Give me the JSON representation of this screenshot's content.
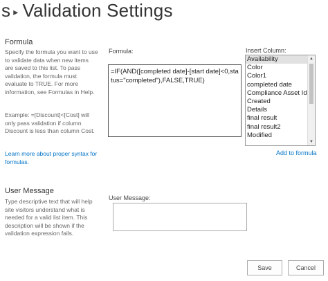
{
  "page": {
    "title_prefix": "s",
    "title": "Validation Settings"
  },
  "formula_section": {
    "heading": "Formula",
    "description": "Specify the formula you want to use to validate data when new items are saved to this list. To pass validation, the formula must evaluate to TRUE. For more information, see Formulas in Help.",
    "example": "Example: =[Discount]<[Cost] will only pass validation if column Discount is less than column Cost.",
    "learn_more": "Learn more about proper syntax for formulas.",
    "formula_label": "Formula:",
    "formula_value": "=IF(AND([completed date]-[start date]<0,status=\"completed\"),FALSE,TRUE)",
    "insert_column_label": "Insert Column:",
    "columns": [
      "Availability",
      "Color",
      "Color1",
      "completed date",
      "Compliance Asset Id",
      "Created",
      "Details",
      "final result",
      "final result2",
      "Modified"
    ],
    "selected_column": "Availability",
    "add_to_formula": "Add to formula"
  },
  "user_message_section": {
    "heading": "User Message",
    "description": "Type descriptive text that will help site visitors understand what is needed for a valid list item. This description will be shown if the validation expression fails.",
    "label": "User Message:",
    "value": ""
  },
  "buttons": {
    "save": "Save",
    "cancel": "Cancel"
  }
}
